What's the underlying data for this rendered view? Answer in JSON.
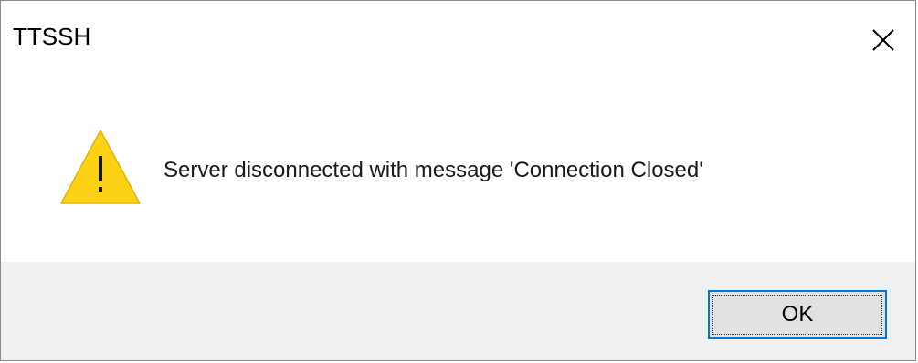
{
  "window": {
    "title": "TTSSH",
    "close_icon": "close-icon"
  },
  "message": {
    "icon": "warning-icon",
    "text": "Server disconnected with message 'Connection Closed'"
  },
  "buttons": {
    "ok_label": "OK"
  },
  "colors": {
    "warning_fill": "#fcd116",
    "focus_border": "#0078d7",
    "footer_bg": "#f0f0f0",
    "button_bg": "#e1e1e1"
  }
}
